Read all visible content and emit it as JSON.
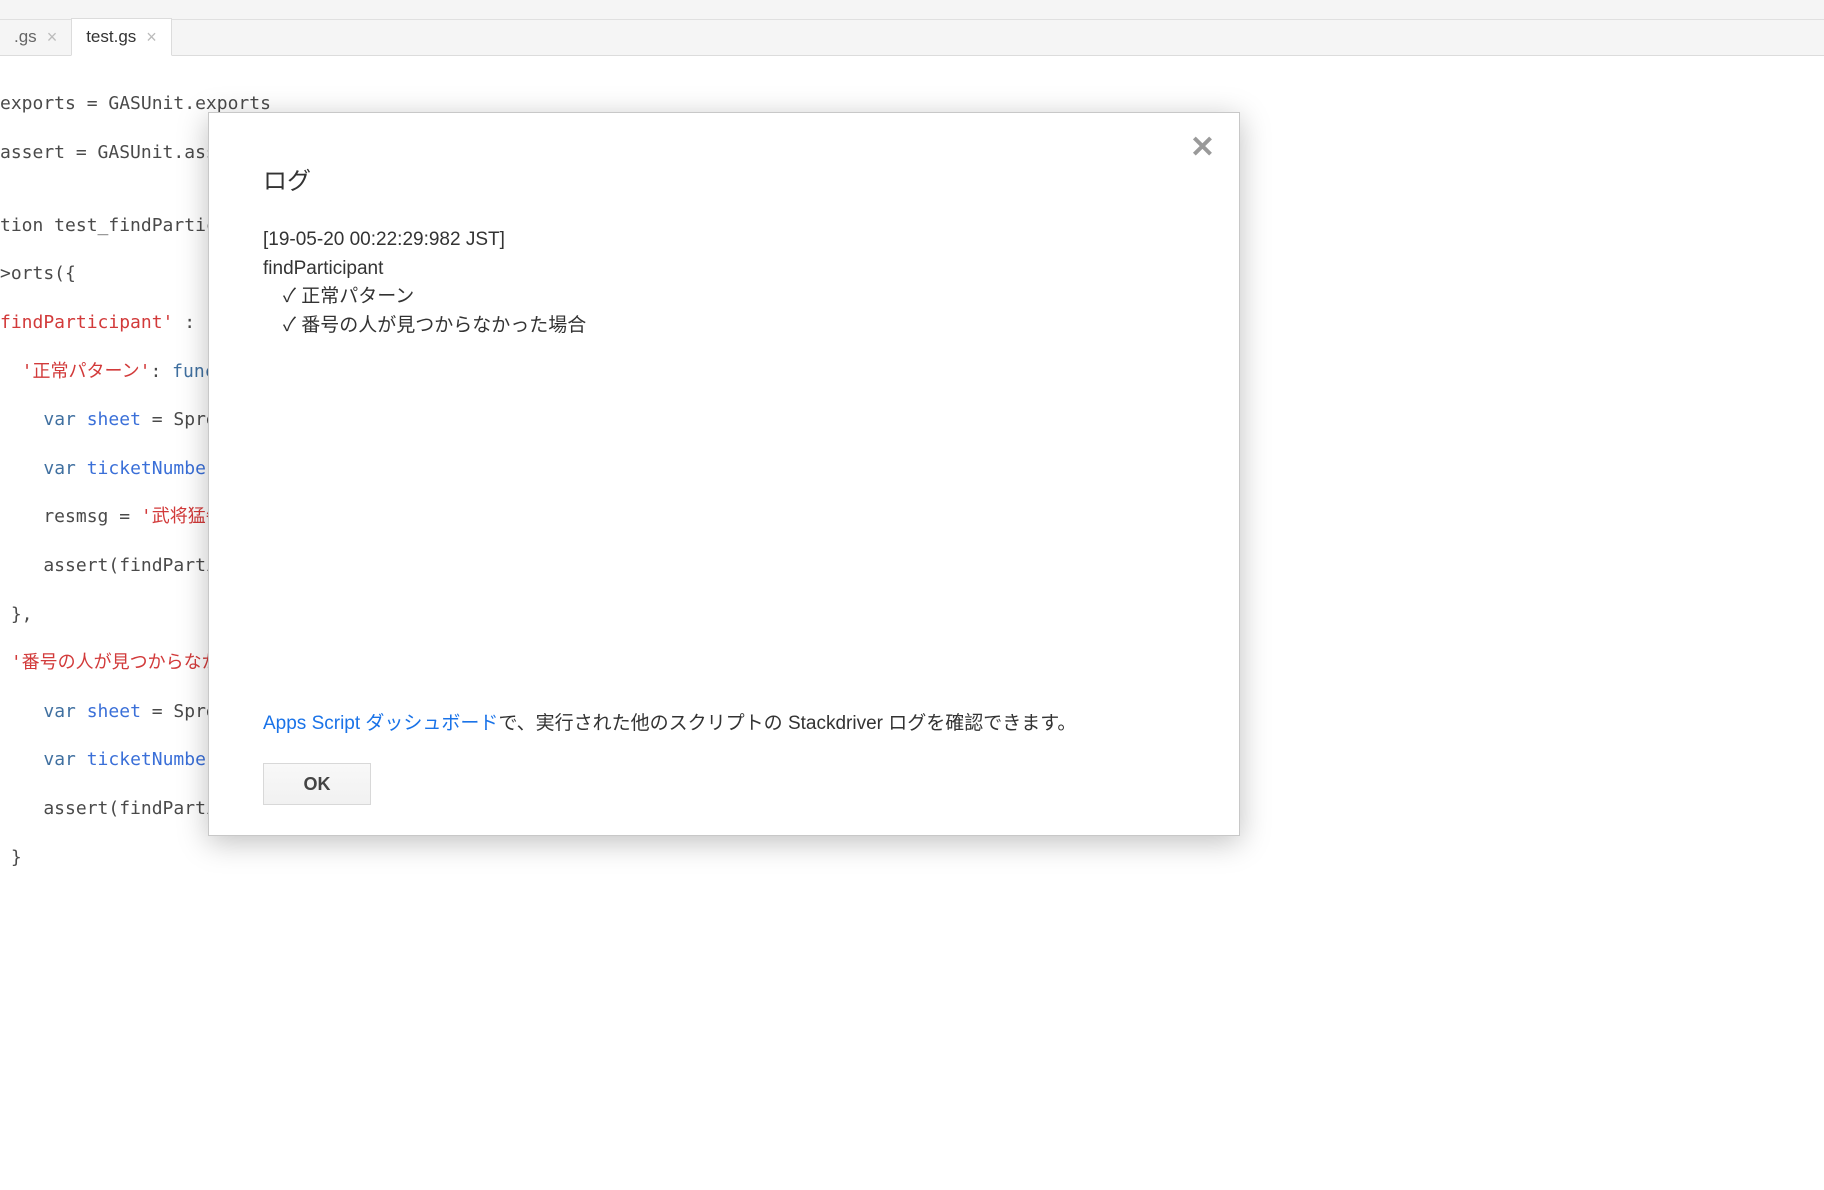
{
  "tabs": [
    {
      "label": ".gs",
      "active": false
    },
    {
      "label": "test.gs",
      "active": true
    }
  ],
  "code": {
    "l1a": "exports = GASUnit.exports",
    "l2a": "assert = GASUnit.assert",
    "l3a": "",
    "l4a": "tion test_findPartic",
    "l5a": ">orts({",
    "l6a": "findParticipant'",
    "l6b": " : ",
    "l7a": "  '正常パターン'",
    "l7b": ": ",
    "l7c": "funct",
    "l8a": "    ",
    "l8b": "var",
    "l8c": " ",
    "l8d": "sheet",
    "l8e": " = Spre",
    "l9a": "    ",
    "l9b": "var",
    "l9c": " ",
    "l9d": "ticketNumber",
    "l10a": "    resmsg = ",
    "l10b": "'武将猛牛",
    "l11a": "    assert(findParti",
    "l12a": " },",
    "l13a": " '番号の人が見つからなか",
    "l14a": "    ",
    "l14b": "var",
    "l14c": " ",
    "l14d": "sheet",
    "l14e": " = Spre",
    "l15a": "    ",
    "l15b": "var",
    "l15c": " ",
    "l15d": "ticketNumber",
    "l16a": "    assert(findParti",
    "l17a": " }"
  },
  "modal": {
    "title": "ログ",
    "timestamp": "[19-05-20 00:22:29:982 JST]",
    "testName": "findParticipant",
    "result1": "✓ 正常パターン",
    "result2": "✓ 番号の人が見つからなかった場合",
    "footerLink": "Apps Script ダッシュボード",
    "footerRest": "で、実行された他のスクリプトの Stackdriver ログを確認できます。",
    "okLabel": "OK",
    "closeSymbol": "✕"
  }
}
